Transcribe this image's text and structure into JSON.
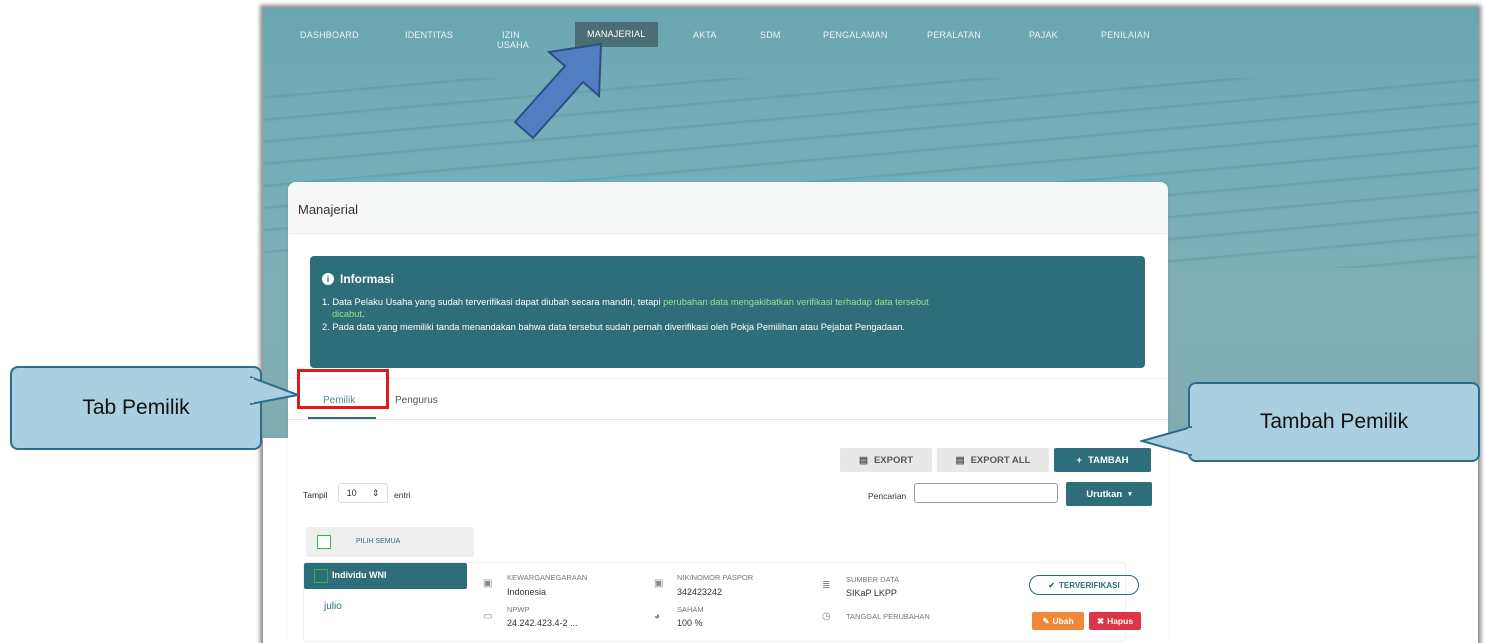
{
  "nav": {
    "items": [
      {
        "label": "DASHBOARD"
      },
      {
        "label": "IDENTITAS"
      },
      {
        "label": "IZIN USAHA"
      },
      {
        "label": "MANAJERIAL"
      },
      {
        "label": "AKTA"
      },
      {
        "label": "SDM"
      },
      {
        "label": "PENGALAMAN"
      },
      {
        "label": "PERALATAN"
      },
      {
        "label": "PAJAK"
      },
      {
        "label": "PENILAIAN"
      }
    ],
    "izin_line1": "IZIN",
    "izin_line2": "USAHA",
    "active": "MANAJERIAL"
  },
  "card": {
    "title": "Manajerial"
  },
  "info": {
    "title": "Informasi",
    "line1_prefix": "1. Data Pelaku Usaha yang sudah terverifikasi dapat diubah secara mandiri, tetapi ",
    "line1_highlight": "perubahan data mengakibatkan verifikasi terhadap data tersebut",
    "line1b_highlight": "dicabut",
    "line1b_suffix": ".",
    "line2": "2. Pada data yang memiliki tanda menandakan bahwa data tersebut sudah pernah diverifikasi oleh Pokja Pemilihan atau Pejabat Pengadaan."
  },
  "tabs": {
    "pemilik": "Pemilik",
    "pengurus": "Pengurus"
  },
  "toolbar": {
    "export": "EXPORT",
    "export_all": "EXPORT ALL",
    "tambah": "TAMBAH"
  },
  "table_controls": {
    "show_prefix": "Tampil",
    "show_value": "10",
    "show_suffix": "entri",
    "search_label": "Pencarian",
    "sort_label": "Urutkan"
  },
  "select_all": "PILIH SEMUA",
  "record": {
    "type": "Individu WNI",
    "name": "julio",
    "kewarganegaraan_label": "KEWARGANEGARAAN",
    "kewarganegaraan": "Indonesia",
    "nik_label": "NIK/NOMOR PASPOR",
    "nik": "342423242",
    "sumber_label": "SUMBER DATA",
    "sumber": "SIKaP LKPP",
    "npwp_label": "NPWP",
    "npwp": "24.242.423.4-2 ...",
    "saham_label": "SAHAM",
    "saham": "100 %",
    "tanggal_label": "TANGGAL PERUBAHAN",
    "status": "TERVERIFIKASI",
    "ubah": "Ubah",
    "hapus": "Hapus"
  },
  "callouts": {
    "tab_pemilik": "Tab Pemilik",
    "tambah_pemilik": "Tambah Pemilik"
  },
  "colors": {
    "primary": "#2e6e7a",
    "highlight": "#9be28b",
    "orange": "#f0883a",
    "red": "#dc3545",
    "callout": "#a9cfe0"
  }
}
